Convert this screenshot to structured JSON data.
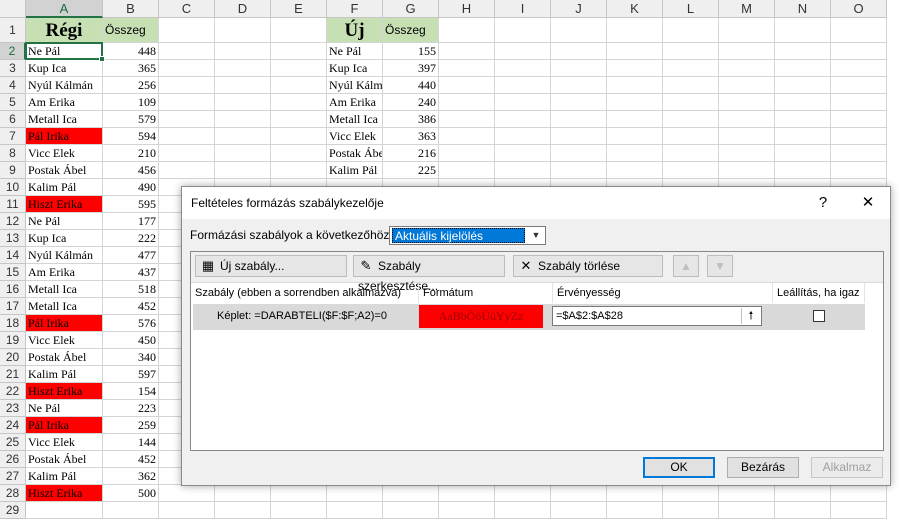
{
  "sheet": {
    "columns": [
      "A",
      "B",
      "C",
      "D",
      "E",
      "F",
      "G",
      "H",
      "I",
      "J",
      "K",
      "L",
      "M",
      "N",
      "O"
    ],
    "rows": [
      "1",
      "2",
      "3",
      "4",
      "5",
      "6",
      "7",
      "8",
      "9",
      "10",
      "11",
      "12",
      "13",
      "14",
      "15",
      "16",
      "17",
      "18",
      "19",
      "20",
      "21",
      "22",
      "23",
      "24",
      "25",
      "26",
      "27",
      "28",
      "29"
    ],
    "regi_title": "Régi",
    "regi_sum_header": "Összeg",
    "uj_title": "Új",
    "uj_sum_header": "Összeg",
    "regi": [
      {
        "name": "Ne Pál",
        "value": "448"
      },
      {
        "name": "Kup Ica",
        "value": "365"
      },
      {
        "name": "Nyúl Kálmán",
        "value": "256"
      },
      {
        "name": "Am Erika",
        "value": "109"
      },
      {
        "name": "Metall Ica",
        "value": "579"
      },
      {
        "name": "Pál Irika",
        "value": "594"
      },
      {
        "name": "Vicc Elek",
        "value": "210"
      },
      {
        "name": "Postak Ábel",
        "value": "456"
      },
      {
        "name": "Kalim Pál",
        "value": "490"
      },
      {
        "name": "Hiszt Erika",
        "value": "595"
      },
      {
        "name": "Ne Pál",
        "value": "177"
      },
      {
        "name": "Kup Ica",
        "value": "222"
      },
      {
        "name": "Nyúl Kálmán",
        "value": "477"
      },
      {
        "name": "Am Erika",
        "value": "437"
      },
      {
        "name": "Metall Ica",
        "value": "518"
      },
      {
        "name": "Metall Ica",
        "value": "452"
      },
      {
        "name": "Pál Irika",
        "value": "576"
      },
      {
        "name": "Vicc Elek",
        "value": "450"
      },
      {
        "name": "Postak Ábel",
        "value": "340"
      },
      {
        "name": "Kalim Pál",
        "value": "597"
      },
      {
        "name": "Hiszt Erika",
        "value": "154"
      },
      {
        "name": "Ne Pál",
        "value": "223"
      },
      {
        "name": "Pál Irika",
        "value": "259"
      },
      {
        "name": "Vicc Elek",
        "value": "144"
      },
      {
        "name": "Postak Ábel",
        "value": "452"
      },
      {
        "name": "Kalim Pál",
        "value": "362"
      },
      {
        "name": "Hiszt Erika",
        "value": "500"
      }
    ],
    "regi_highlighted": [
      5,
      9,
      16,
      20,
      22,
      26
    ],
    "uj": [
      {
        "name": "Ne Pál",
        "value": "155"
      },
      {
        "name": "Kup Ica",
        "value": "397"
      },
      {
        "name": "Nyúl Kálmán",
        "value": "440"
      },
      {
        "name": "Am Erika",
        "value": "240"
      },
      {
        "name": "Metall Ica",
        "value": "386"
      },
      {
        "name": "Vicc Elek",
        "value": "363"
      },
      {
        "name": "Postak Ábel",
        "value": "216"
      },
      {
        "name": "Kalim Pál",
        "value": "225"
      }
    ],
    "colors": {
      "header_fill": "#c6e0b4",
      "highlight": "#ff0000",
      "selection": "#217346"
    }
  },
  "dialog": {
    "title": "Feltételes formázás szabálykezelője",
    "help": "?",
    "close": "✕",
    "show_rules_label": "Formázási szabályok a következőhöz:",
    "show_rules_value": "Aktuális kijelölés",
    "toolbar": {
      "new_rule": "Új szabály...",
      "edit_rule": "Szabály szerkesztése...",
      "delete_rule": "Szabály törlése",
      "move_up": "▲",
      "move_down": "▼"
    },
    "grid_headers": {
      "rule": "Szabály (ebben a sorrendben alkalmazva)",
      "format": "Formátum",
      "applies_to": "Érvényesség",
      "stop_if_true": "Leállítás, ha igaz"
    },
    "rule": {
      "text": "Képlet: =DARABTELI($F:$F;A2)=0",
      "format_preview": "AaBbÖöÜüYyZz",
      "applies_to": "=$A$2:$A$28",
      "stop_if_true": false
    },
    "buttons": {
      "ok": "OK",
      "close": "Bezárás",
      "apply": "Alkalmaz"
    }
  }
}
